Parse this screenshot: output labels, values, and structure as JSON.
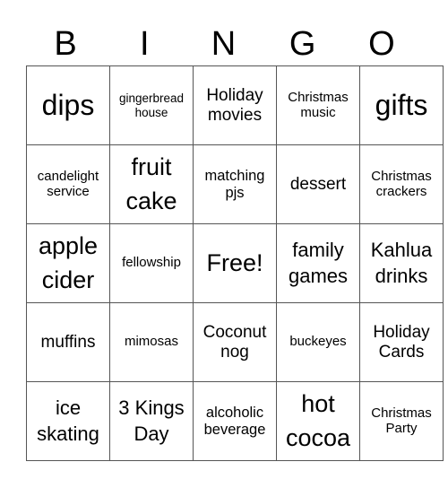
{
  "header": {
    "letters": [
      "B",
      "I",
      "N",
      "G",
      "O"
    ]
  },
  "grid": {
    "rows": [
      [
        "dips",
        "gingerbread house",
        "Holiday movies",
        "Christmas music",
        "gifts"
      ],
      [
        "candelight service",
        "fruit cake",
        "matching pjs",
        "dessert",
        "Christmas crackers"
      ],
      [
        "apple cider",
        "fellowship",
        "Free!",
        "family games",
        "Kahlua drinks"
      ],
      [
        "muffins",
        "mimosas",
        "Coconut nog",
        "buckeyes",
        "Holiday Cards"
      ],
      [
        "ice skating",
        "3 Kings Day",
        "alcoholic beverage",
        "hot cocoa",
        "Christmas Party"
      ]
    ]
  }
}
